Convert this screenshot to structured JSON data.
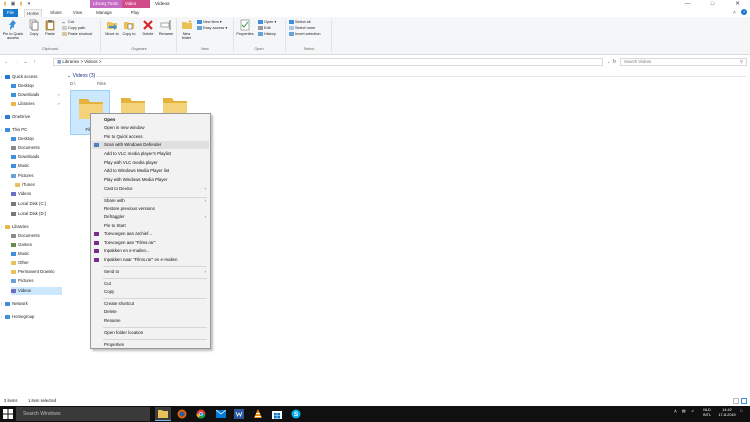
{
  "window": {
    "title": "Videos",
    "contextual_tabs": [
      "Library Tools",
      "Video Tools"
    ],
    "contextual_colors": [
      "#c36ac3",
      "#d14d8a"
    ],
    "contextual_sublabels": [
      "Manage",
      "Play"
    ]
  },
  "tabs": {
    "file": "File",
    "home": "Home",
    "share": "Share",
    "view": "View"
  },
  "ribbon": {
    "pin_quick_access": "Pin to Quick access",
    "copy": "Copy",
    "paste": "Paste",
    "cut": "Cut",
    "copy_path": "Copy path",
    "paste_shortcut": "Paste shortcut",
    "clipboard_label": "Clipboard",
    "move_to": "Move to",
    "copy_to": "Copy to",
    "delete": "Delete",
    "rename": "Rename",
    "organize_label": "Organize",
    "new_folder": "New folder",
    "new_item": "New item",
    "easy_access": "Easy access",
    "new_label": "New",
    "properties": "Properties",
    "open": "Open",
    "edit": "Edit",
    "history": "History",
    "open_label": "Open",
    "select_all": "Select all",
    "select_none": "Select none",
    "invert_selection": "Invert selection",
    "select_label": "Select"
  },
  "address": {
    "path": "Libraries  >  Videos  >",
    "search_placeholder": "Search Videos"
  },
  "nav": {
    "items": [
      {
        "label": "Quick access",
        "icon": "star-icon",
        "color": "#1e7ad6"
      },
      {
        "label": "Desktop",
        "icon": "desktop-icon",
        "color": "#3d8fd9"
      },
      {
        "label": "Downloads",
        "icon": "downloads-icon",
        "color": "#3d8fd9"
      },
      {
        "label": "Libraries",
        "icon": "libraries-icon",
        "color": "#e8b84a"
      },
      {
        "label": "OneDrive",
        "icon": "onedrive-icon",
        "color": "#2f7bd1"
      },
      {
        "label": "This PC",
        "icon": "computer-icon",
        "color": "#3d8fd9"
      },
      {
        "label": "Desktop",
        "icon": "desktop-icon",
        "color": "#3d8fd9"
      },
      {
        "label": "Documents",
        "icon": "documents-icon",
        "color": "#8a8a8a"
      },
      {
        "label": "Downloads",
        "icon": "downloads-icon",
        "color": "#3d8fd9"
      },
      {
        "label": "Music",
        "icon": "music-icon",
        "color": "#3d8fd9"
      },
      {
        "label": "Pictures",
        "icon": "pictures-icon",
        "color": "#6aa0d8"
      },
      {
        "label": "iTunes",
        "icon": "folder-icon",
        "color": "#e8c15a"
      },
      {
        "label": "Videos",
        "icon": "videos-icon",
        "color": "#6a6fbf"
      },
      {
        "label": "Local Disk (C:)",
        "icon": "drive-icon",
        "color": "#777"
      },
      {
        "label": "Local Disk (D:)",
        "icon": "drive-icon",
        "color": "#777"
      },
      {
        "label": "Libraries",
        "icon": "libraries-icon",
        "color": "#e8b84a"
      },
      {
        "label": "Documents",
        "icon": "documents-icon",
        "color": "#8a8a8a"
      },
      {
        "label": "Games",
        "icon": "games-icon",
        "color": "#6a8a4a"
      },
      {
        "label": "Music",
        "icon": "music-icon",
        "color": "#3d8fd9"
      },
      {
        "label": "Other",
        "icon": "folder-icon",
        "color": "#e8c15a"
      },
      {
        "label": "Permanent Downlo",
        "icon": "folder-icon",
        "color": "#e8c15a"
      },
      {
        "label": "Pictures",
        "icon": "pictures-icon",
        "color": "#6aa0d8"
      },
      {
        "label": "Videos",
        "icon": "videos-icon",
        "color": "#6a6fbf"
      },
      {
        "label": "Network",
        "icon": "network-icon",
        "color": "#3d8fd9"
      },
      {
        "label": "Homegroup",
        "icon": "homegroup-icon",
        "color": "#3d8fd9"
      }
    ]
  },
  "content": {
    "group_header": "Videos (3)",
    "col_drive": "D:\\",
    "col_files": "Files",
    "folders": [
      {
        "label": "Files"
      },
      {
        "label": ""
      },
      {
        "label": ""
      }
    ]
  },
  "context_menu": {
    "items": [
      "Open",
      "Open in new window",
      "Pin to Quick access",
      "Scan with Windows Defender",
      "Add to VLC media player's Playlist",
      "Play with VLC media player",
      "Add to Windows Media Player list",
      "Play with Windows Media Player",
      "Cast to Device",
      "Share with",
      "Restore previous versions",
      "Defraggler",
      "Pin to Start",
      "Toevoegen aan archief...",
      "Toevoegen aan \"Films.rar\"",
      "Inpakken en e-mailen...",
      "Inpakken naar \"Films.rar\" en e-mailen",
      "Send to",
      "Cut",
      "Copy",
      "Create shortcut",
      "Delete",
      "Rename",
      "Open folder location",
      "Properties"
    ]
  },
  "status": {
    "count": "3 items",
    "selected": "1 item selected"
  },
  "taskbar": {
    "search_placeholder": "Search Windows",
    "lang_1": "NLD",
    "lang_2": "INTL",
    "time": "14:42",
    "date": "17-8-2015"
  }
}
